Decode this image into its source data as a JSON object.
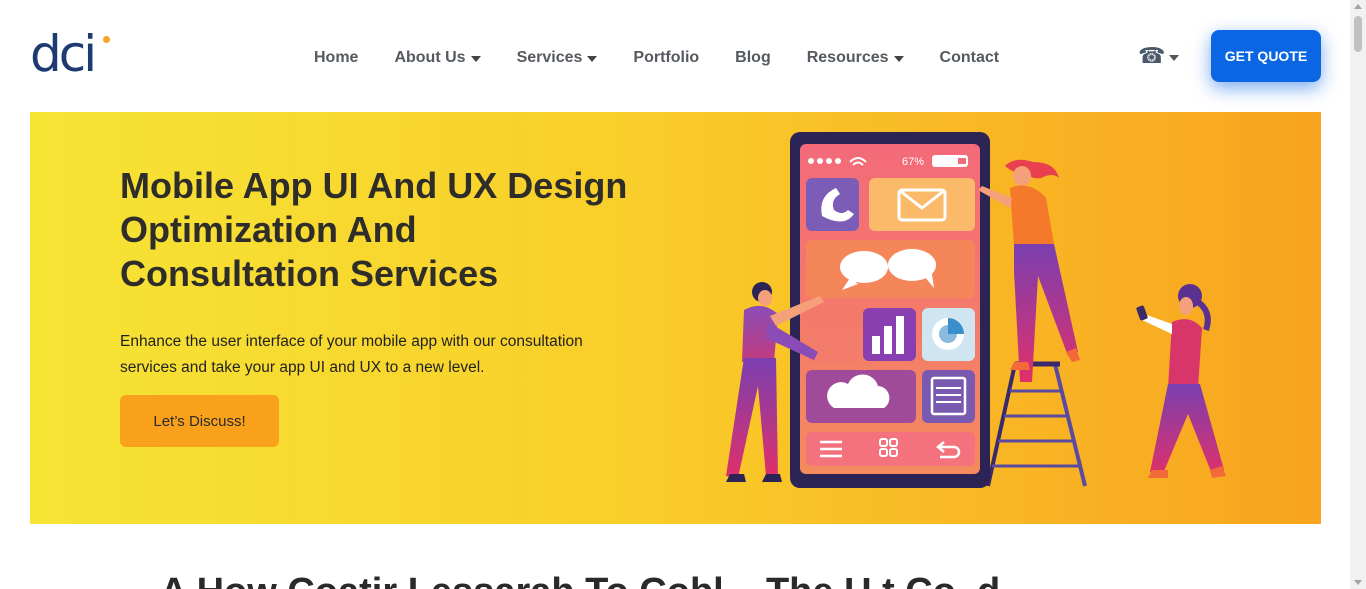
{
  "logo": {
    "text": "dci"
  },
  "nav": {
    "items": [
      {
        "label": "Home",
        "dropdown": false
      },
      {
        "label": "About Us",
        "dropdown": true
      },
      {
        "label": "Services",
        "dropdown": true
      },
      {
        "label": "Portfolio",
        "dropdown": false
      },
      {
        "label": "Blog",
        "dropdown": false
      },
      {
        "label": "Resources",
        "dropdown": true
      },
      {
        "label": "Contact",
        "dropdown": false
      }
    ],
    "phone_icon": "telephone-icon",
    "quote_label": "GET QUOTE"
  },
  "hero": {
    "title_lines": [
      "Mobile App UI And UX Design",
      "Optimization And",
      "Consultation Services"
    ],
    "description": "Enhance the user interface of your mobile app with our consultation services and take your app UI and UX to a new level.",
    "cta_label": "Let’s Discuss!",
    "illustration": {
      "battery_text": "67%",
      "icons": [
        "phone-icon",
        "mail-icon",
        "chat-icon",
        "bar-chart-icon",
        "pie-chart-icon",
        "cloud-icon",
        "document-icon",
        "menu-icon",
        "grid-icon",
        "back-icon"
      ]
    }
  },
  "next_section": {
    "title": "A How Coatir Lessarah To Cobl... The U.t Co..d..."
  },
  "colors": {
    "brand_navy": "#1d3a73",
    "logo_accent": "#f5a623",
    "quote_blue": "#0b66e4",
    "hero_yellow": "#f6e435",
    "hero_orange": "#f7a41f",
    "cta_orange": "#f9a11b"
  }
}
